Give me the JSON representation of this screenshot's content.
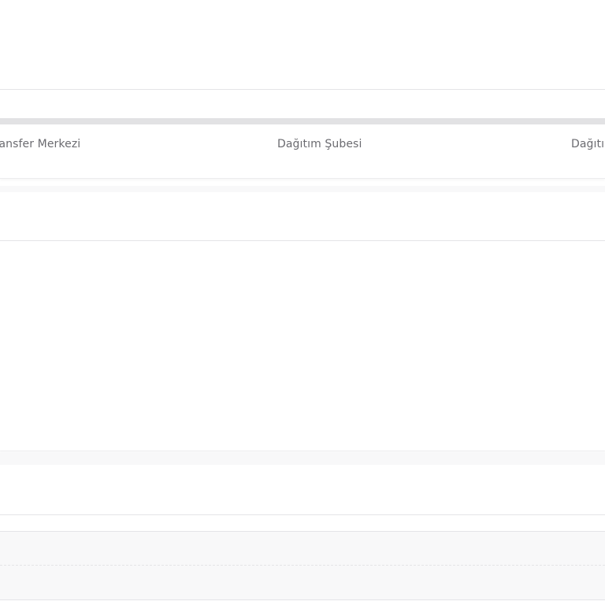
{
  "tracking_steps": {
    "items": [
      {
        "label": "Transfer Merkezi"
      },
      {
        "label": "Dağıtım Şubesi"
      },
      {
        "label": "Dağıtım"
      }
    ],
    "progress_fraction": 1.0
  },
  "colors": {
    "background": "#ffffff",
    "divider": "#e4e4e7",
    "progress_track": "#e2e2e4",
    "label_text": "#6b6b70",
    "band": "#f8f8f9"
  }
}
